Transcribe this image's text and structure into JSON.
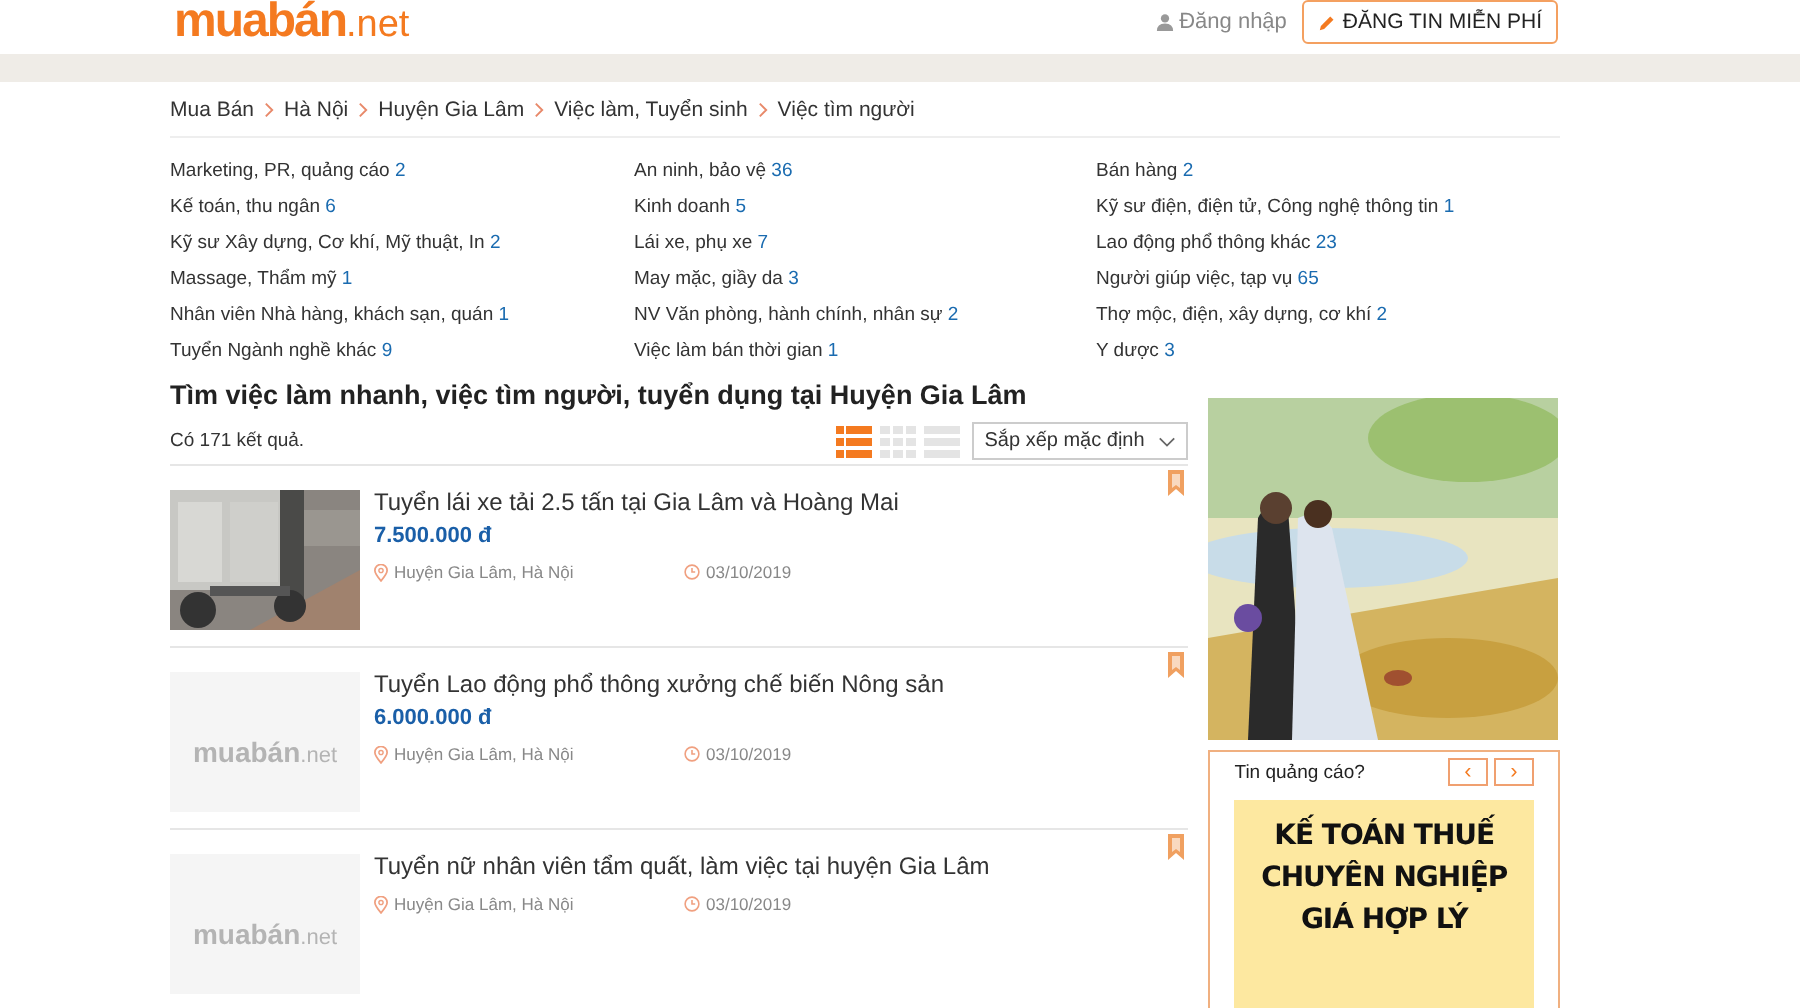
{
  "header": {
    "logo_main": "muabán",
    "logo_suffix": ".net",
    "login": "Đăng nhập",
    "post_button": "ĐĂNG TIN MIỄN PHÍ"
  },
  "breadcrumb": [
    "Mua Bán",
    "Hà Nội",
    "Huyện Gia Lâm",
    "Việc làm, Tuyển sinh",
    "Việc tìm người"
  ],
  "categories": [
    {
      "label": "Marketing, PR, quảng cáo",
      "count": "2"
    },
    {
      "label": "An ninh, bảo vệ",
      "count": "36"
    },
    {
      "label": "Bán hàng",
      "count": "2"
    },
    {
      "label": "Kế toán, thu ngân",
      "count": "6"
    },
    {
      "label": "Kinh doanh",
      "count": "5"
    },
    {
      "label": "Kỹ sư điện, điện tử, Công nghệ thông tin",
      "count": "1"
    },
    {
      "label": "Kỹ sư Xây dựng, Cơ khí, Mỹ thuật, In",
      "count": "2"
    },
    {
      "label": "Lái xe, phụ xe",
      "count": "7"
    },
    {
      "label": "Lao động phổ thông khác",
      "count": "23"
    },
    {
      "label": "Massage, Thẩm mỹ",
      "count": "1"
    },
    {
      "label": "May mặc, giầy da",
      "count": "3"
    },
    {
      "label": "Người giúp việc, tạp vụ",
      "count": "65"
    },
    {
      "label": "Nhân viên Nhà hàng, khách sạn, quán",
      "count": "1"
    },
    {
      "label": "NV Văn phòng, hành chính, nhân sự",
      "count": "2"
    },
    {
      "label": "Thợ mộc, điện, xây dựng, cơ khí",
      "count": "2"
    },
    {
      "label": "Tuyển Ngành nghề khác",
      "count": "9"
    },
    {
      "label": "Việc làm bán thời gian",
      "count": "1"
    },
    {
      "label": "Y dược",
      "count": "3"
    }
  ],
  "heading": "Tìm việc làm nhanh, việc tìm người, tuyển dụng tại Huyện Gia Lâm",
  "result_count": "Có 171 kết quả.",
  "views": [
    {
      "kind": "list",
      "selected": true
    },
    {
      "kind": "grid",
      "selected": false
    },
    {
      "kind": "rows",
      "selected": false
    }
  ],
  "sort": "Sắp xếp mặc định",
  "listings": [
    {
      "title": "Tuyển lái xe tải 2.5 tấn tại Gia Lâm và Hoàng Mai",
      "price": "7.500.000 đ",
      "location": "Huyện Gia Lâm, Hà Nội",
      "date": "03/10/2019"
    },
    {
      "kind": "placeholder",
      "thumb_main": "muabán",
      "thumb_suffix": ".net",
      "title": "Tuyển Lao động phổ thông xưởng chế biến Nông sản",
      "price": "6.000.000 đ",
      "location": "Huyện Gia Lâm, Hà Nội",
      "date": "03/10/2019"
    },
    {
      "kind": "placeholder",
      "thumb_main": "muabán",
      "thumb_suffix": ".net",
      "title": "Tuyển nữ nhân viên tẩm quất, làm việc tại huyện Gia Lâm",
      "location": "Huyện Gia Lâm, Hà Nội",
      "date": "03/10/2019"
    }
  ],
  "sidebar": {
    "ad_label": "Tin quảng cáo?",
    "prev": "‹",
    "next": "›",
    "banner_lines": [
      "KẾ TOÁN THUẾ",
      "CHUYÊN NGHIỆP",
      "GIÁ HỢP LÝ"
    ]
  }
}
